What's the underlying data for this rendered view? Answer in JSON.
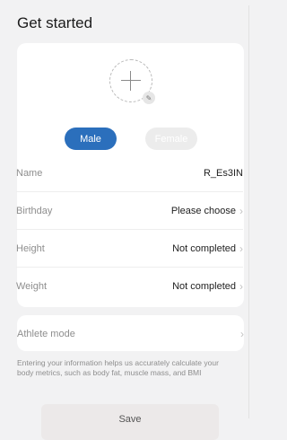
{
  "header": {
    "title": "Get started"
  },
  "profile": {
    "gender": {
      "male": "Male",
      "female": "Female",
      "selected": "Male"
    },
    "fields": [
      {
        "label": "Name",
        "value": "R_Es3IN",
        "chevron": false
      },
      {
        "label": "Birthday",
        "value": "Please choose",
        "chevron": true
      },
      {
        "label": "Height",
        "value": "Not completed",
        "chevron": true
      },
      {
        "label": "Weight",
        "value": "Not completed",
        "chevron": true
      }
    ]
  },
  "athlete": {
    "label": "Athlete mode"
  },
  "note": "Entering your information helps us accurately calculate your body metrics, such as body fat, muscle mass, and BMI",
  "actions": {
    "save_label": "Save"
  },
  "icons": {
    "avatar": "plus-icon",
    "edit": "pencil-icon",
    "row": "chevron-right-icon"
  },
  "colors": {
    "accent": "#2b6fbc",
    "background": "#f2f2f3"
  }
}
